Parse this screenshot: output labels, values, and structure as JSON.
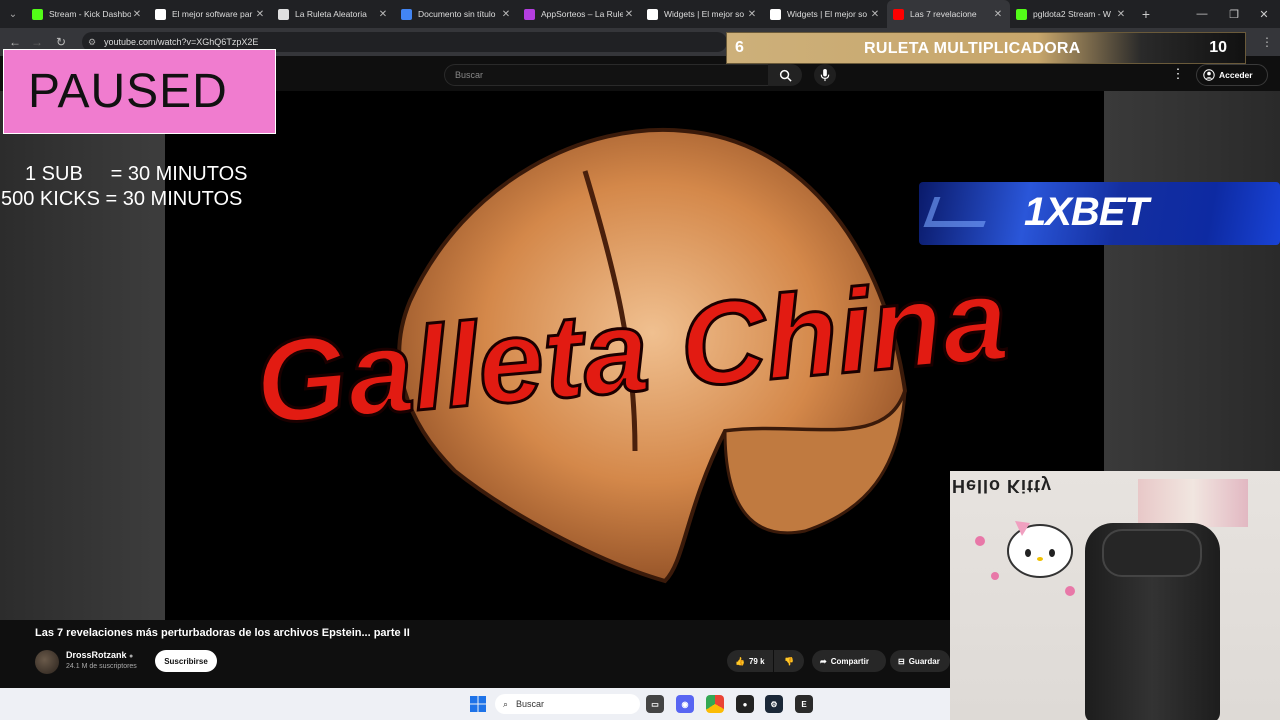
{
  "browser": {
    "tabs": [
      {
        "title": "Stream - Kick Dashbo",
        "color": "#53fc18",
        "icon": "kick-icon"
      },
      {
        "title": "El mejor software par",
        "color": "#ffffff",
        "icon": "diamond-icon"
      },
      {
        "title": "La Ruleta Aleatoria",
        "color": "#e0e0e0",
        "icon": "globe-icon"
      },
      {
        "title": "Documento sin título",
        "color": "#4285f4",
        "icon": "docs-icon"
      },
      {
        "title": "AppSorteos – La Rule",
        "color": "#b43ee0",
        "icon": "appsorteos-icon"
      },
      {
        "title": "Widgets | El mejor so",
        "color": "#ffffff",
        "icon": "diamond-icon"
      },
      {
        "title": "Widgets | El mejor so",
        "color": "#ffffff",
        "icon": "diamond-icon"
      },
      {
        "title": "Las 7 revelacione",
        "color": "#ff0000",
        "icon": "youtube-icon",
        "active": true
      },
      {
        "title": "pgldota2 Stream - W",
        "color": "#53fc18",
        "icon": "kick-icon"
      }
    ],
    "url": "youtube.com/watch?v=XGhQ6TzpX2E"
  },
  "youtube": {
    "search_placeholder": "Buscar",
    "sign_in": "Acceder",
    "video_title": "Las 7 revelaciones más perturbadoras de los archivos Epstein... parte II",
    "channel_name": "DrossRotzank",
    "subscribers": "24.1 M de suscriptores",
    "subscribe": "Suscribirse",
    "likes": "79 k",
    "share": "Compartir",
    "save": "Guardar",
    "thumbnail_text": "Galleta China"
  },
  "overlay": {
    "paused": "PAUSED",
    "timer_line1": "1 SUB     = 30 MINUTOS",
    "timer_line2": "500 KICKS = 30 MINUTOS",
    "roulette_left": "6",
    "roulette_title": "RULETA MULTIPLICADORA",
    "roulette_right": "10",
    "sponsor": "1XBET",
    "webcam_sign": "Hello Kitty"
  },
  "taskbar": {
    "search": "Buscar"
  }
}
